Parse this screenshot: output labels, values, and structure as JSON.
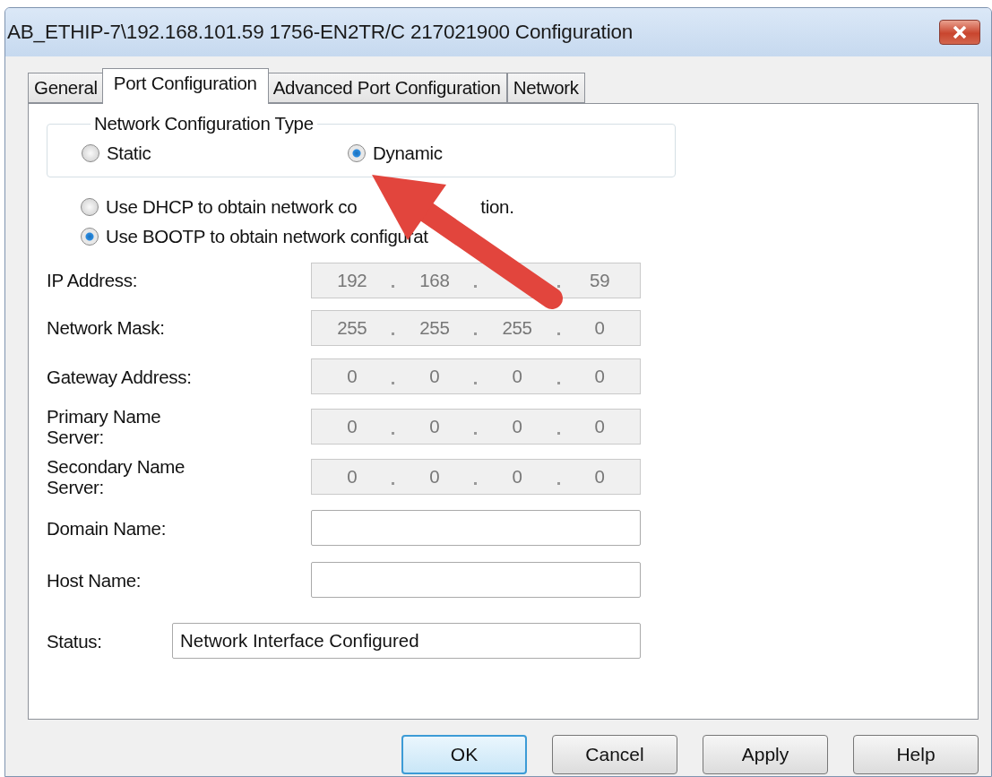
{
  "window": {
    "title": "AB_ETHIP-7\\192.168.101.59 1756-EN2TR/C 217021900 Configuration"
  },
  "tabs": [
    {
      "label": "General",
      "selected": false
    },
    {
      "label": "Port Configuration",
      "selected": true
    },
    {
      "label": "Advanced Port Configuration",
      "selected": false
    },
    {
      "label": "Network",
      "selected": false
    }
  ],
  "network_configuration_type": {
    "legend": "Network Configuration Type",
    "options": [
      {
        "label": "Static",
        "selected": false
      },
      {
        "label": "Dynamic",
        "selected": true
      }
    ]
  },
  "obtain_options": [
    {
      "label_parts": [
        "Use DHCP to obtain network co",
        "tion."
      ],
      "selected": false
    },
    {
      "label_parts": [
        "Use BOOTP to obtain network configurat"
      ],
      "selected": true
    }
  ],
  "address_fields": [
    {
      "label": "IP Address:",
      "octets": [
        {
          "text": "192"
        },
        {
          "text": "168"
        },
        {
          "covered": true
        },
        {
          "text": "59"
        }
      ],
      "disabled": true
    },
    {
      "label": "Network Mask:",
      "octets": [
        {
          "text": "255"
        },
        {
          "text": "255"
        },
        {
          "text": "255"
        },
        {
          "text": "0"
        }
      ],
      "disabled": true
    },
    {
      "label": "Gateway Address:",
      "octets": [
        {
          "text": "0"
        },
        {
          "text": "0"
        },
        {
          "text": "0"
        },
        {
          "text": "0"
        }
      ],
      "disabled": true
    },
    {
      "label": "Primary Name Server:",
      "octets": [
        {
          "text": "0"
        },
        {
          "text": "0"
        },
        {
          "text": "0"
        },
        {
          "text": "0"
        }
      ],
      "disabled": true
    },
    {
      "label": "Secondary Name Server:",
      "octets": [
        {
          "text": "0"
        },
        {
          "text": "0"
        },
        {
          "text": "0"
        },
        {
          "text": "0"
        }
      ],
      "disabled": true
    }
  ],
  "text_fields": [
    {
      "label": "Domain Name:"
    },
    {
      "label": "Host Name:"
    }
  ],
  "status": {
    "label": "Status:",
    "value": "Network Interface Configured"
  },
  "buttons": [
    {
      "label": "OK",
      "default": true
    },
    {
      "label": "Cancel",
      "default": false
    },
    {
      "label": "Apply",
      "default": false
    },
    {
      "label": "Help",
      "default": false
    }
  ]
}
